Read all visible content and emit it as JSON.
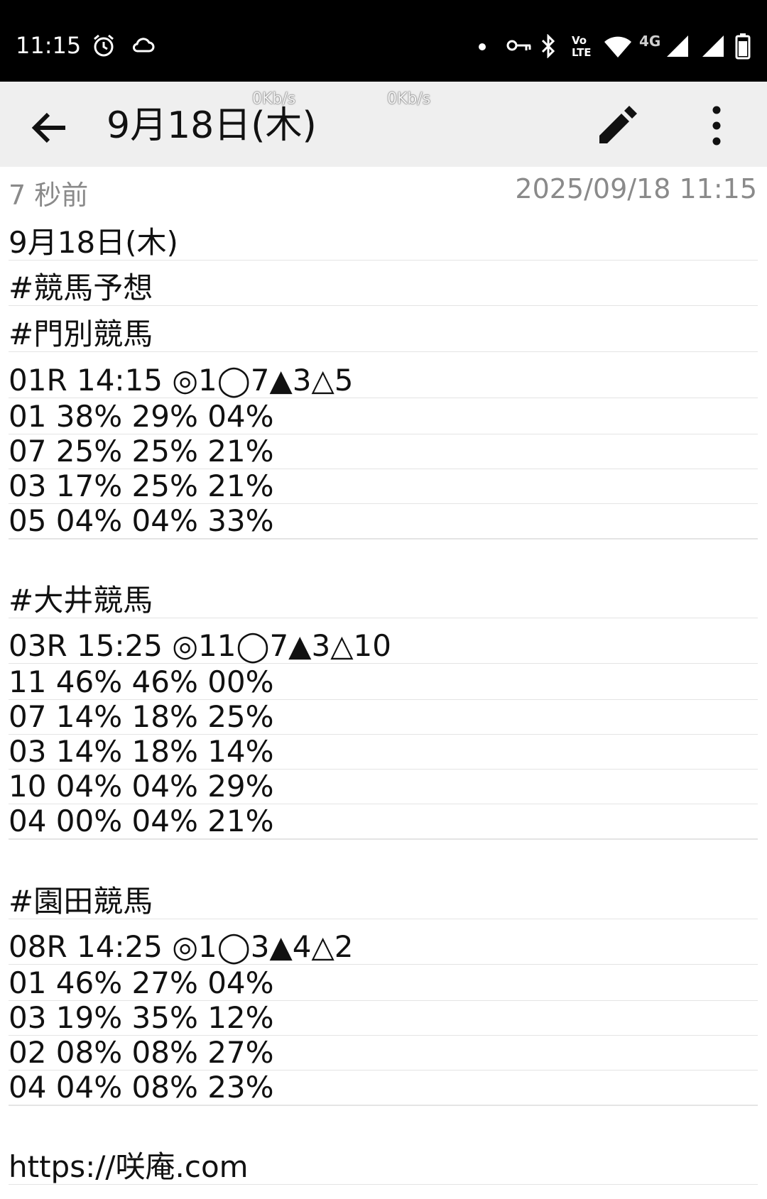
{
  "status_bar": {
    "time": "11:15",
    "icons": [
      "alarm-icon",
      "cloud-icon",
      "dot-icon",
      "vpn-key-icon",
      "bluetooth-icon",
      "volte-icon",
      "wifi-icon",
      "signal-icon",
      "signal-icon",
      "battery-icon"
    ],
    "network_label": "4G",
    "volte_label_top": "Vo",
    "volte_label_bottom": "LTE"
  },
  "app_bar": {
    "title": "9月18日(木)",
    "net_speed_1": "0Kb/s",
    "net_speed_2": "0Kb/s",
    "back_icon": "arrow-back-icon",
    "edit_icon": "pencil-icon",
    "more_icon": "more-vert-icon"
  },
  "meta": {
    "relative_time": "7 秒前",
    "timestamp": "2025/09/18 11:15"
  },
  "note": {
    "lines": [
      "9月18日(木)",
      "#競馬予想",
      "#門別競馬",
      "01R 14:15 ◎1◯7▲3△5",
      "01 38% 29% 04%",
      "07 25% 25% 21%",
      "03 17% 25% 21%",
      "05 04% 04% 33%",
      "",
      "#大井競馬",
      "03R 15:25 ◎11◯7▲3△10",
      "11 46% 46% 00%",
      "07 14% 18% 25%",
      "03 14% 18% 14%",
      "10 04% 04% 29%",
      "04 00% 04% 21%",
      "",
      "#園田競馬",
      "08R 14:25 ◎1◯3▲4△2",
      "01 46% 27% 04%",
      "03 19% 35% 12%",
      "02 08% 08% 27%",
      "04 04% 08% 23%",
      "",
      "https://咲庵.com"
    ]
  },
  "colors": {
    "status_bar_bg": "#000000",
    "app_bar_bg": "#efefef",
    "meta_text": "#8a8a8a",
    "body_text": "#111111"
  }
}
